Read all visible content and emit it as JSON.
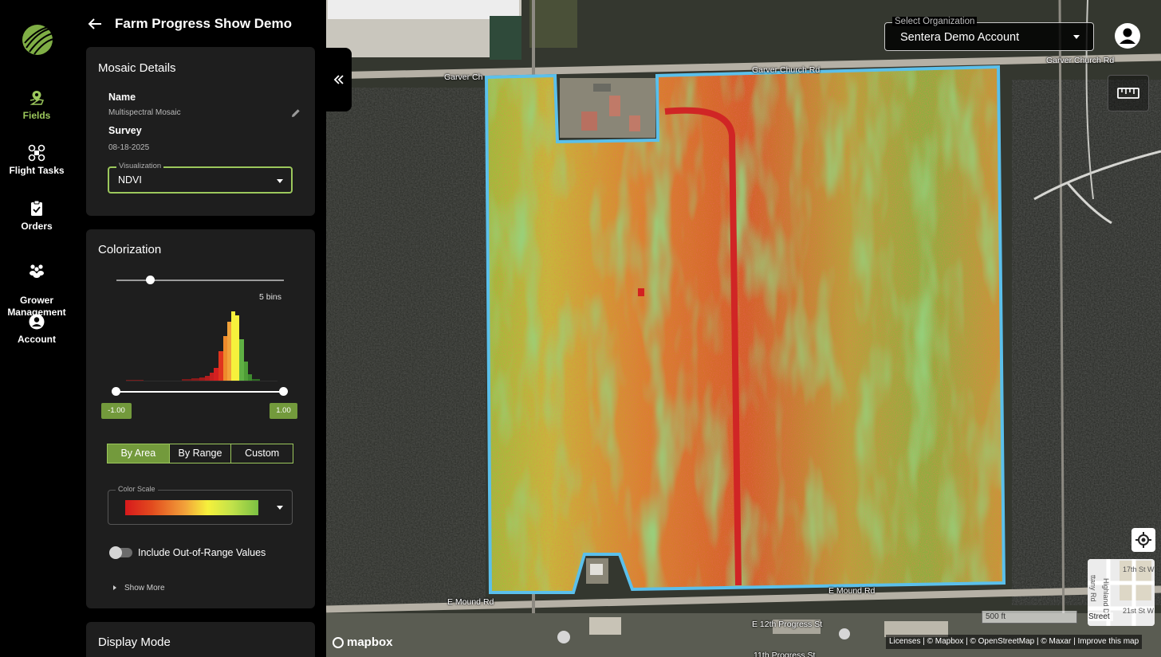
{
  "nav": {
    "items": [
      {
        "label": "Fields",
        "icon": "map-pin-icon"
      },
      {
        "label": "Flight Tasks",
        "icon": "drone-icon"
      },
      {
        "label": "Orders",
        "icon": "clipboard-icon"
      },
      {
        "label": "Grower\nManagement",
        "icon": "group-icon"
      },
      {
        "label": "Account",
        "icon": "account-icon"
      }
    ]
  },
  "header": {
    "title": "Farm Progress Show Demo"
  },
  "mosaic": {
    "heading": "Mosaic Details",
    "name_label": "Name",
    "name_value": "Multispectral Mosaic",
    "survey_label": "Survey",
    "survey_value": "08-18-2025",
    "visualization_label": "Visualization",
    "visualization_value": "NDVI"
  },
  "colorization": {
    "heading": "Colorization",
    "bins_label": "5 bins",
    "bins_slider_level": 0.2,
    "range_min": "-1.00",
    "range_max": "1.00",
    "modes": [
      "By Area",
      "By Range",
      "Custom"
    ],
    "selected_mode": "By Area",
    "color_scale_label": "Color Scale",
    "include_out_of_range": "Include Out-of-Range Values",
    "show_more": "Show More"
  },
  "display_mode": {
    "heading": "Display Mode"
  },
  "map": {
    "org_label": "Select Organization",
    "org_value": "Sentera Demo Account",
    "roads": {
      "garver_left": "Garver Ch",
      "garver_right": "Garver Church Rd",
      "mound_left": "E Mound Rd",
      "mound_right": "E Mound Rd",
      "progress": "E 12th Progress St",
      "progress_11": "11th Progress St",
      "st17": "17th St W",
      "highland": "Highland D",
      "st21": "21st St W",
      "tany": "ttany Rd"
    },
    "scale_label": "500 ft",
    "style_label": "Street",
    "brand": "mapbox",
    "attribution": "Licenses | © Mapbox | © OpenStreetMap | © Maxar | Improve this map"
  },
  "colors": {
    "accent": "#9cc85c",
    "accent_dark": "#739a3c",
    "field_outline": "#5bc0eb"
  }
}
